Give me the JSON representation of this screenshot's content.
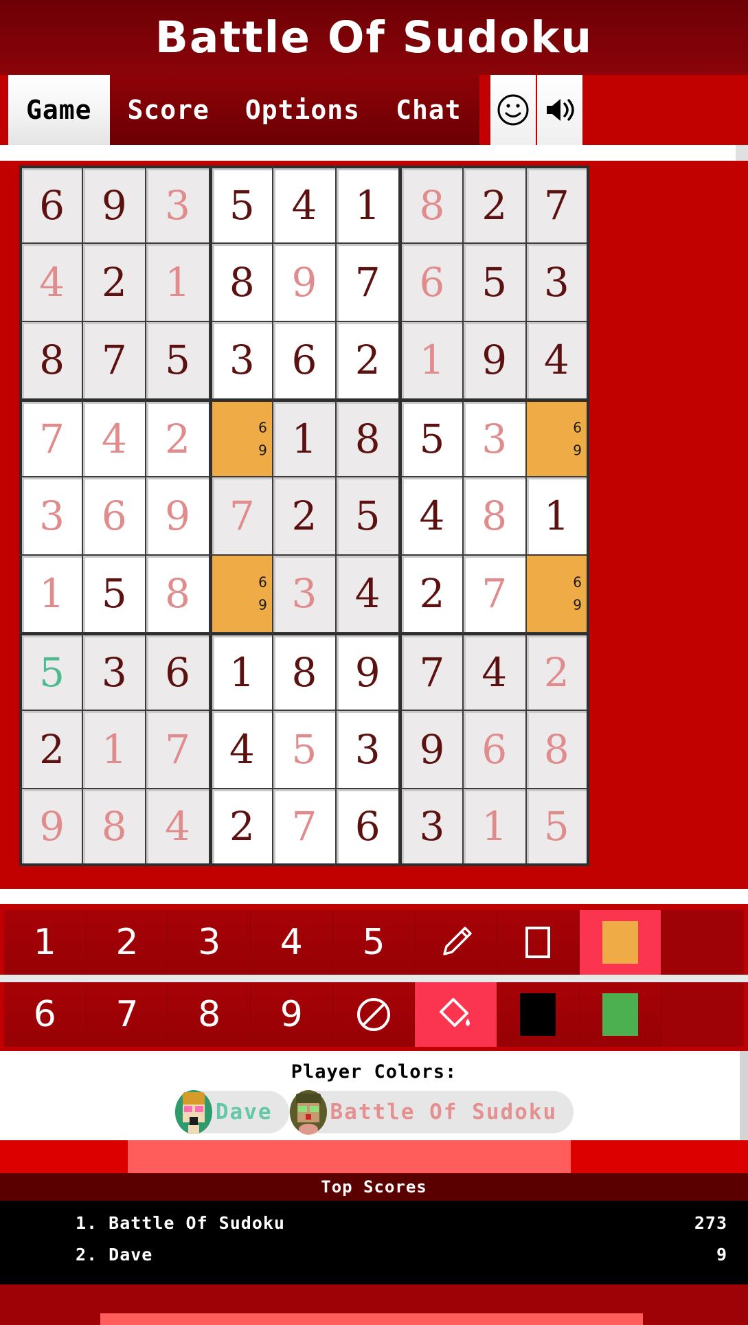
{
  "app": {
    "title": "Battle Of Sudoku",
    "accent_dark": "#7d0207",
    "accent_red": "#c10000",
    "highlight_color": "#efab45",
    "player_pink": "#e08c8c",
    "player_green": "#4fba90",
    "given_color": "#5c1111"
  },
  "tabs": [
    {
      "label": "Game",
      "active": true
    },
    {
      "label": "Score",
      "active": false
    },
    {
      "label": "Options",
      "active": false
    },
    {
      "label": "Chat",
      "active": false
    }
  ],
  "tab_icons": [
    {
      "name": "smiley-icon"
    },
    {
      "name": "speaker-icon"
    }
  ],
  "board": {
    "rows": [
      [
        {
          "v": "6",
          "o": "given"
        },
        {
          "v": "9",
          "o": "given"
        },
        {
          "v": "3",
          "o": "pink"
        },
        {
          "v": "5",
          "o": "given"
        },
        {
          "v": "4",
          "o": "given"
        },
        {
          "v": "1",
          "o": "given"
        },
        {
          "v": "8",
          "o": "pink"
        },
        {
          "v": "2",
          "o": "given"
        },
        {
          "v": "7",
          "o": "given"
        }
      ],
      [
        {
          "v": "4",
          "o": "pink"
        },
        {
          "v": "2",
          "o": "given"
        },
        {
          "v": "1",
          "o": "pink"
        },
        {
          "v": "8",
          "o": "given"
        },
        {
          "v": "9",
          "o": "pink"
        },
        {
          "v": "7",
          "o": "given"
        },
        {
          "v": "6",
          "o": "pink"
        },
        {
          "v": "5",
          "o": "given"
        },
        {
          "v": "3",
          "o": "given"
        }
      ],
      [
        {
          "v": "8",
          "o": "given"
        },
        {
          "v": "7",
          "o": "given"
        },
        {
          "v": "5",
          "o": "given"
        },
        {
          "v": "3",
          "o": "given"
        },
        {
          "v": "6",
          "o": "given"
        },
        {
          "v": "2",
          "o": "given"
        },
        {
          "v": "1",
          "o": "pink"
        },
        {
          "v": "9",
          "o": "given"
        },
        {
          "v": "4",
          "o": "given"
        }
      ],
      [
        {
          "v": "7",
          "o": "pink"
        },
        {
          "v": "4",
          "o": "pink"
        },
        {
          "v": "2",
          "o": "pink"
        },
        {
          "v": "",
          "o": "none",
          "hl": true,
          "notes": [
            "6",
            "9"
          ]
        },
        {
          "v": "1",
          "o": "given"
        },
        {
          "v": "8",
          "o": "given"
        },
        {
          "v": "5",
          "o": "given"
        },
        {
          "v": "3",
          "o": "pink"
        },
        {
          "v": "",
          "o": "none",
          "hl": true,
          "notes": [
            "6",
            "9"
          ]
        }
      ],
      [
        {
          "v": "3",
          "o": "pink"
        },
        {
          "v": "6",
          "o": "pink"
        },
        {
          "v": "9",
          "o": "pink"
        },
        {
          "v": "7",
          "o": "pink"
        },
        {
          "v": "2",
          "o": "given"
        },
        {
          "v": "5",
          "o": "given"
        },
        {
          "v": "4",
          "o": "given"
        },
        {
          "v": "8",
          "o": "pink"
        },
        {
          "v": "1",
          "o": "given"
        }
      ],
      [
        {
          "v": "1",
          "o": "pink"
        },
        {
          "v": "5",
          "o": "given"
        },
        {
          "v": "8",
          "o": "pink"
        },
        {
          "v": "",
          "o": "none",
          "hl": true,
          "notes": [
            "6",
            "9"
          ]
        },
        {
          "v": "3",
          "o": "pink"
        },
        {
          "v": "4",
          "o": "given"
        },
        {
          "v": "2",
          "o": "given"
        },
        {
          "v": "7",
          "o": "pink"
        },
        {
          "v": "",
          "o": "none",
          "hl": true,
          "notes": [
            "6",
            "9"
          ]
        }
      ],
      [
        {
          "v": "5",
          "o": "green"
        },
        {
          "v": "3",
          "o": "given"
        },
        {
          "v": "6",
          "o": "given"
        },
        {
          "v": "1",
          "o": "given"
        },
        {
          "v": "8",
          "o": "given"
        },
        {
          "v": "9",
          "o": "given"
        },
        {
          "v": "7",
          "o": "given"
        },
        {
          "v": "4",
          "o": "given"
        },
        {
          "v": "2",
          "o": "pink"
        }
      ],
      [
        {
          "v": "2",
          "o": "given"
        },
        {
          "v": "1",
          "o": "pink"
        },
        {
          "v": "7",
          "o": "pink"
        },
        {
          "v": "4",
          "o": "given"
        },
        {
          "v": "5",
          "o": "pink"
        },
        {
          "v": "3",
          "o": "given"
        },
        {
          "v": "9",
          "o": "given"
        },
        {
          "v": "6",
          "o": "pink"
        },
        {
          "v": "8",
          "o": "pink"
        }
      ],
      [
        {
          "v": "9",
          "o": "pink"
        },
        {
          "v": "8",
          "o": "pink"
        },
        {
          "v": "4",
          "o": "pink"
        },
        {
          "v": "2",
          "o": "given"
        },
        {
          "v": "7",
          "o": "pink"
        },
        {
          "v": "6",
          "o": "given"
        },
        {
          "v": "3",
          "o": "given"
        },
        {
          "v": "1",
          "o": "pink"
        },
        {
          "v": "5",
          "o": "pink"
        }
      ]
    ]
  },
  "pad_row_1": [
    {
      "label": "1",
      "kind": "number",
      "name": "pad-number-1"
    },
    {
      "label": "2",
      "kind": "number",
      "name": "pad-number-2"
    },
    {
      "label": "3",
      "kind": "number",
      "name": "pad-number-3"
    },
    {
      "label": "4",
      "kind": "number",
      "name": "pad-number-4"
    },
    {
      "label": "5",
      "kind": "number",
      "name": "pad-number-5"
    },
    {
      "label": "",
      "kind": "pencil",
      "name": "pencil-icon"
    },
    {
      "label": "",
      "kind": "square",
      "name": "square-outline-icon"
    },
    {
      "label": "",
      "kind": "swatch-orange",
      "name": "color-swatch-orange",
      "accent": true
    }
  ],
  "pad_row_2": [
    {
      "label": "6",
      "kind": "number",
      "name": "pad-number-6"
    },
    {
      "label": "7",
      "kind": "number",
      "name": "pad-number-7"
    },
    {
      "label": "8",
      "kind": "number",
      "name": "pad-number-8"
    },
    {
      "label": "9",
      "kind": "number",
      "name": "pad-number-9"
    },
    {
      "label": "",
      "kind": "prohibit",
      "name": "erase-icon"
    },
    {
      "label": "",
      "kind": "bucket",
      "name": "paint-bucket-icon",
      "accent": true
    },
    {
      "label": "",
      "kind": "swatch-black",
      "name": "color-swatch-black"
    },
    {
      "label": "",
      "kind": "swatch-green",
      "name": "color-swatch-green"
    }
  ],
  "players": {
    "heading": "Player Colors:",
    "list": [
      {
        "name": "Dave",
        "color": "#63c7a8"
      },
      {
        "name": "Battle Of Sudoku",
        "color": "#e59090"
      }
    ]
  },
  "scores": {
    "heading": "Top Scores",
    "rows": [
      {
        "rank_name": "1. Battle Of Sudoku",
        "points": "273"
      },
      {
        "rank_name": "2. Dave",
        "points": "9"
      }
    ]
  }
}
